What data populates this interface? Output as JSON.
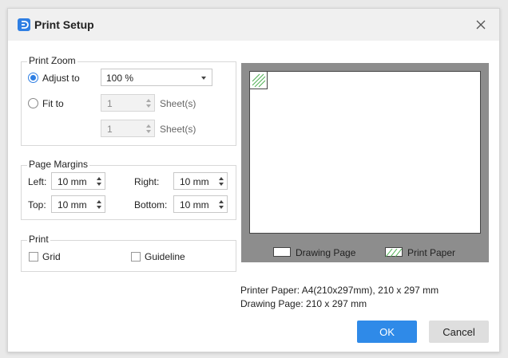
{
  "dialog": {
    "title": "Print Setup"
  },
  "print_zoom": {
    "legend": "Print Zoom",
    "adjust_to_label": "Adjust to",
    "adjust_to_value": "100 %",
    "fit_to_label": "Fit to",
    "fit_to_width_value": "1",
    "fit_to_height_value": "1",
    "sheets_label": "Sheet(s)",
    "selected": "Adjust to"
  },
  "page_margins": {
    "legend": "Page Margins",
    "left_label": "Left:",
    "left_value": "10 mm",
    "right_label": "Right:",
    "right_value": "10 mm",
    "top_label": "Top:",
    "top_value": "10 mm",
    "bottom_label": "Bottom:",
    "bottom_value": "10 mm"
  },
  "print": {
    "legend": "Print",
    "grid_label": "Grid",
    "grid_checked": false,
    "guideline_label": "Guideline",
    "guideline_checked": false
  },
  "preview": {
    "drawing_page_label": "Drawing Page",
    "print_paper_label": "Print Paper",
    "background_color": "#8d8d8d",
    "hatch_color": "#4caf50"
  },
  "info": {
    "printer_paper": "Printer Paper: A4(210x297mm), 210 x 297 mm",
    "drawing_page": "Drawing Page: 210 x 297 mm"
  },
  "buttons": {
    "ok": "OK",
    "cancel": "Cancel",
    "accent_color": "#2f8ae8"
  }
}
